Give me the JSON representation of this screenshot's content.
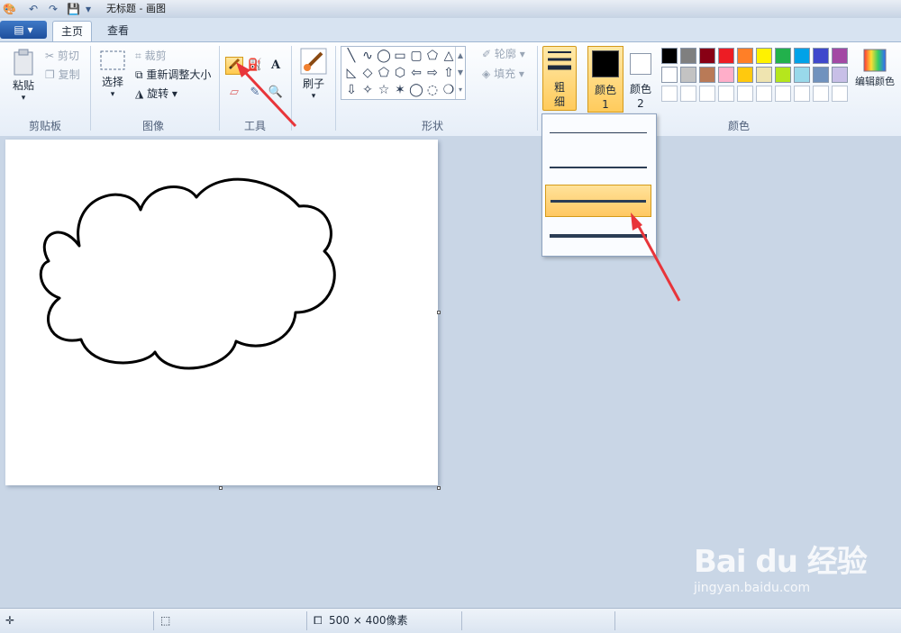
{
  "window": {
    "title": "无标题 - 画图",
    "quick_access": [
      "🎨",
      "↶",
      "↷",
      "💾",
      "▾"
    ]
  },
  "tabs": {
    "menu": "▤ ▾",
    "home": "主页",
    "view": "查看"
  },
  "clipboard": {
    "paste": "粘贴",
    "cut": "剪切",
    "copy": "复制",
    "label": "剪贴板"
  },
  "image": {
    "select": "选择",
    "crop": "裁剪",
    "resize": "重新调整大小",
    "rotate": "旋转 ▾",
    "label": "图像"
  },
  "tools": {
    "label": "工具",
    "text_tool_glyph": "A"
  },
  "brushes": {
    "label": "刷子"
  },
  "shapes": {
    "label": "形状",
    "outline": "轮廓 ▾",
    "fill": "填充 ▾"
  },
  "size": {
    "label": "粗细",
    "dropdown_lines": [
      1,
      2,
      3,
      4
    ],
    "selected_index": 2
  },
  "colors": {
    "color1": "颜色 1",
    "color1_value": "#000000",
    "color2": "颜色 2",
    "color2_value": "#ffffff",
    "edit": "编辑颜色",
    "label": "颜色",
    "palette_row1": [
      "#000000",
      "#7f7f7f",
      "#880015",
      "#ed1c24",
      "#ff7f27",
      "#fff200",
      "#22b14c",
      "#00a2e8",
      "#3f48cc",
      "#a349a4"
    ],
    "palette_row2": [
      "#ffffff",
      "#c3c3c3",
      "#b97a57",
      "#ffaec9",
      "#ffc90e",
      "#efe4b0",
      "#b5e61d",
      "#99d9ea",
      "#7092be",
      "#c8bfe7"
    ]
  },
  "status": {
    "image_size": "500 × 400像素"
  },
  "watermark": {
    "logo": "Bai du 经验",
    "url": "jingyan.baidu.com"
  },
  "accent": "#e8353a"
}
